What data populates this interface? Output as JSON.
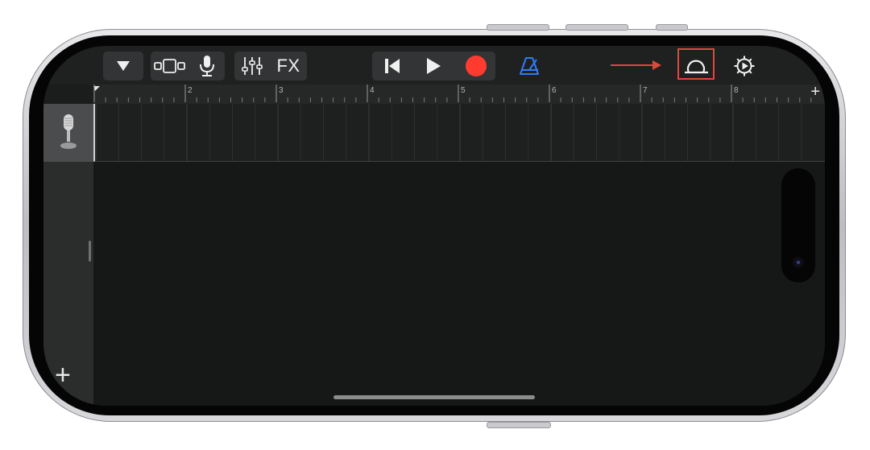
{
  "toolbar": {
    "tracks_menu": "tracks-dropdown",
    "view_toggle": "tracks-view",
    "input_icon": "microphone",
    "mixer_icon": "track-controls",
    "fx_label": "FX",
    "transport": {
      "rewind": "go-to-beginning",
      "play": "play",
      "record": "record"
    },
    "metronome": "metronome",
    "loop_browser": "loop-browser",
    "settings": "song-settings"
  },
  "ruler": {
    "bar_numbers": [
      "2",
      "3",
      "4",
      "5",
      "6",
      "7",
      "8"
    ],
    "add_section": "+"
  },
  "track_header": {
    "instrument_icon": "microphone-icon"
  },
  "add_track_label": "+",
  "colors": {
    "record": "#ff3b30",
    "metronome": "#2f7cf6",
    "annotation": "#e0473b"
  }
}
